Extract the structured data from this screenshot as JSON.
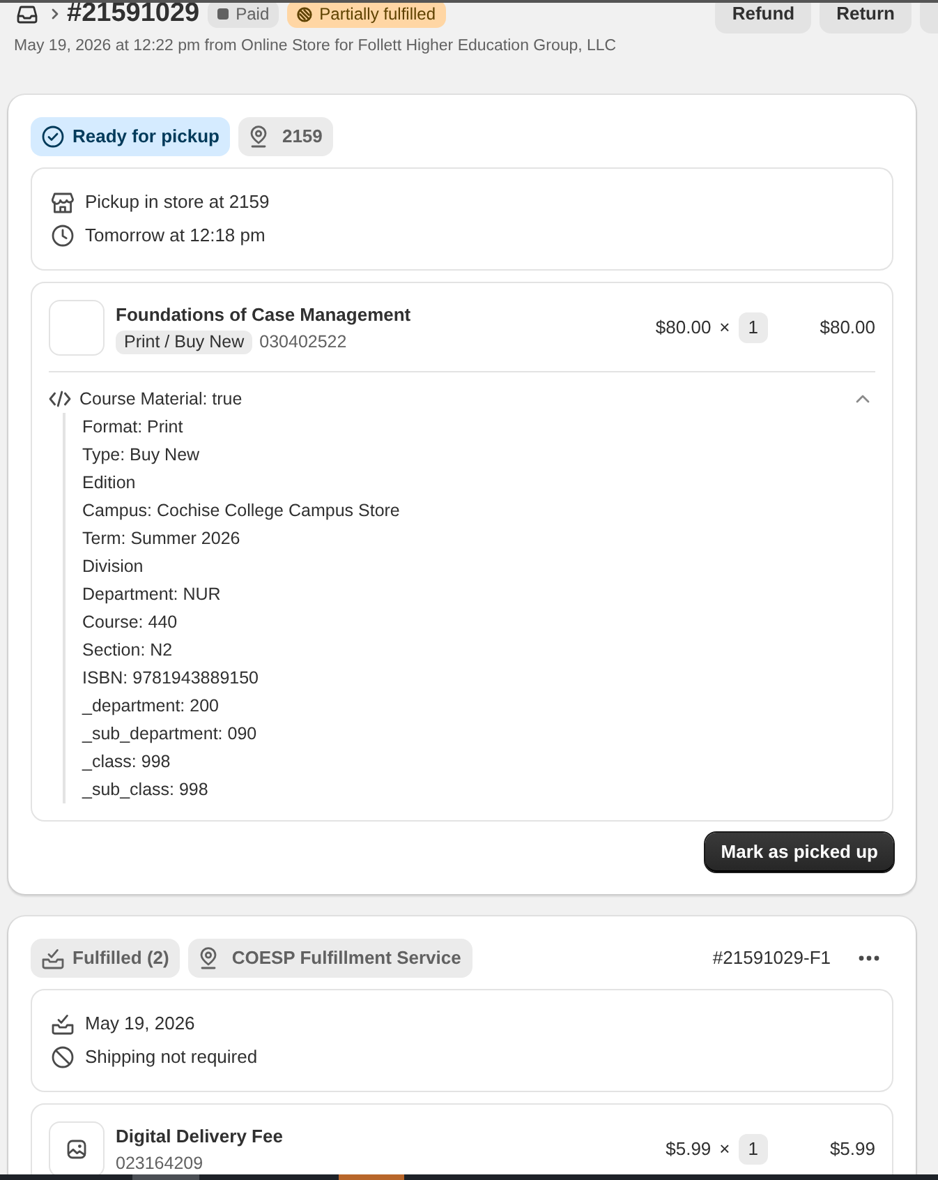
{
  "header": {
    "order_number": "#21591029",
    "badges": [
      {
        "label": "Paid",
        "kind": "paid"
      },
      {
        "label": "Partially fulfilled",
        "kind": "partially_fulfilled"
      }
    ],
    "actions": [
      "Refund",
      "Return"
    ],
    "subtitle": "May 19, 2026 at 12:22 pm from Online Store for Follett Higher Education Group, LLC"
  },
  "fulfillments": [
    {
      "status": {
        "label": "Ready for pickup",
        "kind": "ready"
      },
      "location": "2159",
      "details": [
        {
          "kind": "store",
          "text": "Pickup in store at 2159"
        },
        {
          "kind": "clock",
          "text": "Tomorrow at 12:18 pm"
        }
      ],
      "items": [
        {
          "thumbnail": {
            "kind": "unavailable"
          },
          "title": "Foundations of Case Management",
          "variant": "Print / Buy New",
          "sku": "030402522",
          "price": "$80.00",
          "times": "×",
          "quantity": "1",
          "total": "$80.00",
          "properties": {
            "expanded": true,
            "lines": [
              "Course Material: true",
              "Format: Print",
              "Type: Buy New",
              "Edition",
              "Campus: Cochise College Campus Store",
              "Term: Summer 2026",
              "Division",
              "Department: NUR",
              "Course: 440",
              "Section: N2",
              "ISBN: 9781943889150",
              "_department: 200",
              "_sub_department: 090",
              "_class: 998",
              "_sub_class: 998"
            ]
          }
        }
      ],
      "action": "Mark as picked up"
    },
    {
      "status": {
        "label": "Fulfilled (2)",
        "kind": "fulfilled"
      },
      "location": "COESP Fulfillment Service",
      "reference": "#21591029-F1",
      "has_menu": true,
      "details": [
        {
          "kind": "fulfilled",
          "text": "May 19, 2026"
        },
        {
          "kind": "no_shipping",
          "text": "Shipping not required"
        }
      ],
      "items": [
        {
          "thumbnail": {
            "kind": "image"
          },
          "title": "Digital Delivery Fee",
          "sku": "023164209",
          "price": "$5.99",
          "times": "×",
          "quantity": "1",
          "total": "$5.99"
        }
      ]
    }
  ]
}
